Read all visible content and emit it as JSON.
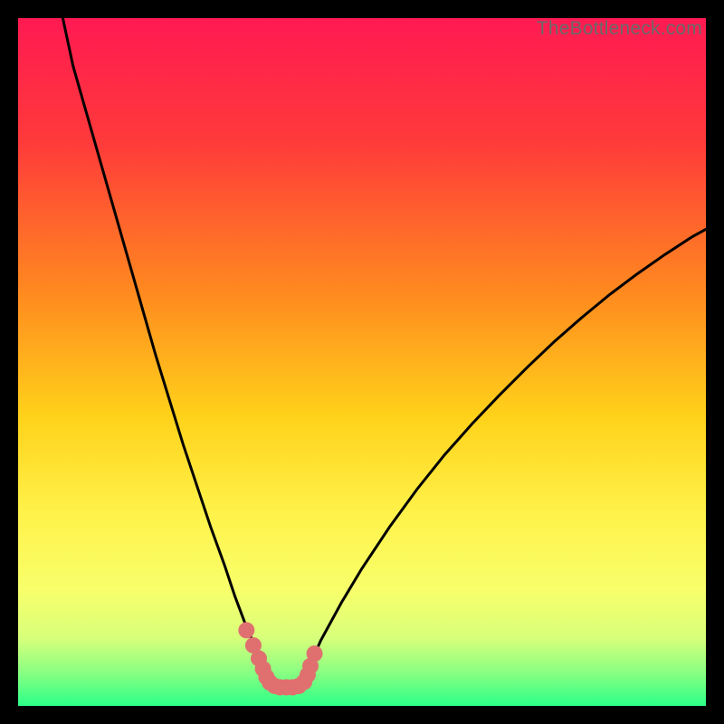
{
  "watermark": "TheBottleneck.com",
  "chart_data": {
    "type": "line",
    "title": "",
    "xlabel": "",
    "ylabel": "",
    "xlim": [
      0,
      100
    ],
    "ylim": [
      0,
      100
    ],
    "background_gradient_stops": [
      {
        "pos": 0.0,
        "color": "#ff1a52"
      },
      {
        "pos": 0.18,
        "color": "#ff3a3a"
      },
      {
        "pos": 0.4,
        "color": "#ff8a1f"
      },
      {
        "pos": 0.58,
        "color": "#ffd21a"
      },
      {
        "pos": 0.72,
        "color": "#fff24a"
      },
      {
        "pos": 0.83,
        "color": "#f8ff6a"
      },
      {
        "pos": 0.9,
        "color": "#d9ff7a"
      },
      {
        "pos": 0.95,
        "color": "#8cff82"
      },
      {
        "pos": 1.0,
        "color": "#2bff87"
      }
    ],
    "series": [
      {
        "name": "curve-left",
        "stroke": "#000000",
        "stroke_width": 3,
        "x": [
          6.5,
          8,
          10,
          12,
          14,
          16,
          18,
          20,
          22,
          24,
          26,
          28,
          30,
          31.5,
          33,
          34.5,
          35.8
        ],
        "y": [
          100,
          93,
          86,
          79,
          72,
          65,
          58,
          51,
          44.5,
          38,
          32,
          26,
          20.5,
          16,
          12,
          8.5,
          5.6
        ]
      },
      {
        "name": "curve-right",
        "stroke": "#000000",
        "stroke_width": 3,
        "x": [
          42.3,
          44,
          47,
          50,
          54,
          58,
          62,
          66,
          70,
          74,
          78,
          82,
          86,
          90,
          94,
          98,
          100
        ],
        "y": [
          5.6,
          9.5,
          15,
          20,
          26,
          31.5,
          36.5,
          41,
          45.2,
          49.2,
          53,
          56.5,
          59.8,
          62.8,
          65.6,
          68.2,
          69.3
        ]
      },
      {
        "name": "marker-trail",
        "type": "scatter",
        "stroke": "#e07070",
        "fill": "#e07070",
        "radius": 9,
        "x": [
          33.2,
          34.2,
          35.0,
          35.6,
          36.1,
          36.6,
          37.3,
          38.1,
          39.0,
          39.9,
          40.8,
          41.6,
          42.1,
          42.5,
          43.1
        ],
        "y": [
          11.0,
          8.8,
          6.9,
          5.4,
          4.2,
          3.4,
          2.9,
          2.7,
          2.7,
          2.7,
          2.9,
          3.5,
          4.5,
          5.8,
          7.6
        ]
      }
    ],
    "green_band": {
      "y0": 0.0,
      "y1": 5.0,
      "color": "#2bff87"
    }
  }
}
